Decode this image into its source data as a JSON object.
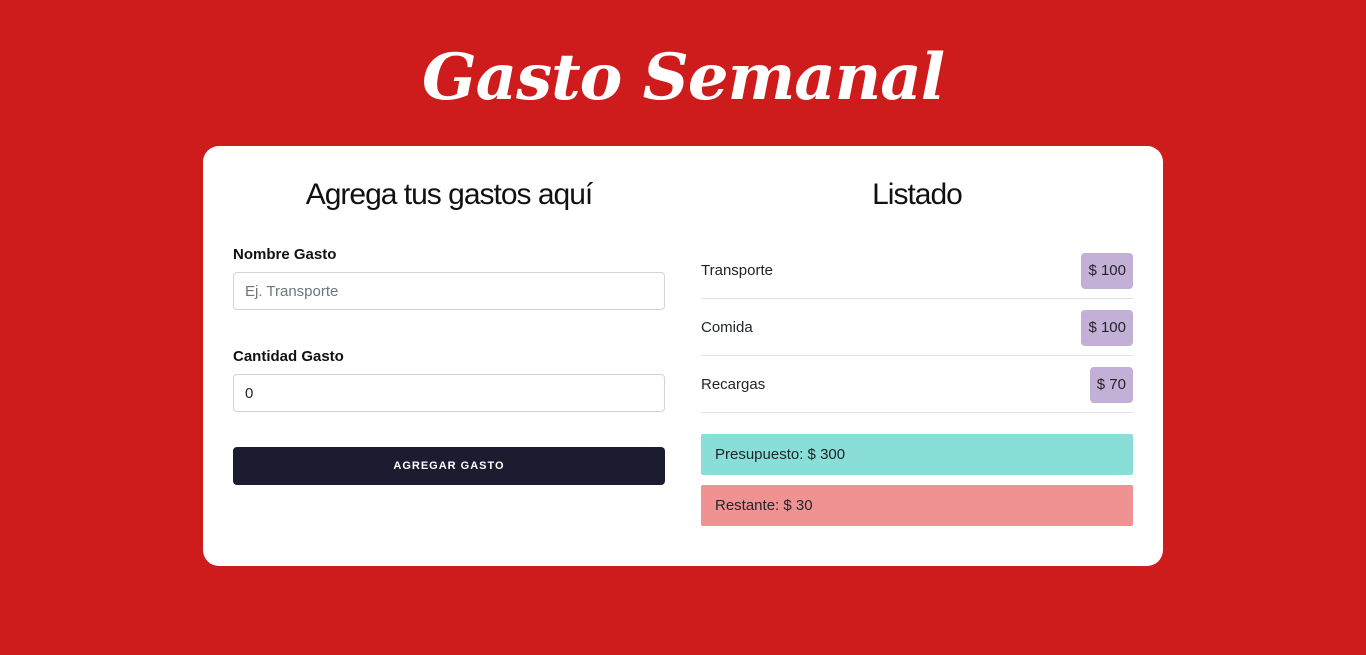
{
  "header": {
    "title": "Gasto Semanal"
  },
  "form": {
    "title": "Agrega tus gastos aquí",
    "name_label": "Nombre Gasto",
    "name_value": "",
    "name_placeholder": "Ej. Transporte",
    "amount_label": "Cantidad Gasto",
    "amount_value": "0",
    "submit_label": "AGREGAR GASTO"
  },
  "list": {
    "title": "Listado",
    "items": [
      {
        "name": "Transporte",
        "amount": "$ 100"
      },
      {
        "name": "Comida",
        "amount": "$ 100"
      },
      {
        "name": "Recargas",
        "amount": "$ 70"
      }
    ],
    "budget_text": "Presupuesto: $ 300",
    "remaining_text": "Restante: $ 30"
  },
  "colors": {
    "background": "#ce1c1c",
    "button": "#1b1c2f",
    "badge": "#c2b0d6",
    "budget_alert": "#89dfd8",
    "remaining_alert": "#f09292"
  }
}
